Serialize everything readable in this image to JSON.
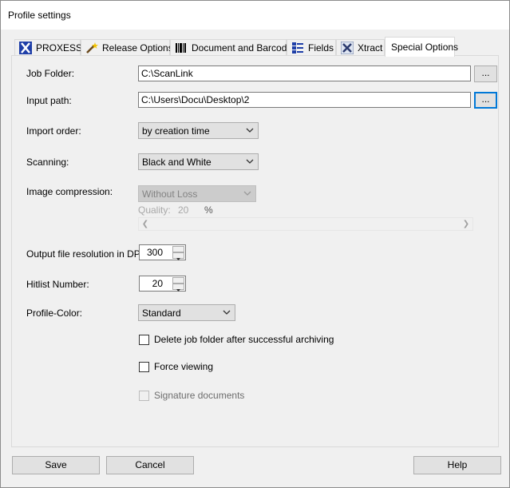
{
  "window": {
    "title": "Profile settings"
  },
  "tabs": [
    {
      "label": "PROXESS",
      "icon": "proxess-x-icon"
    },
    {
      "label": "Release Options",
      "icon": "magic-wand-icon"
    },
    {
      "label": "Document and Barcode",
      "icon": "barcode-icon"
    },
    {
      "label": "Fields",
      "icon": "fields-icon"
    },
    {
      "label": "Xtract",
      "icon": "xtract-icon"
    },
    {
      "label": "Special Options",
      "active": true
    }
  ],
  "form": {
    "job_folder": {
      "label": "Job Folder:",
      "value": "C:\\ScanLink",
      "browse": "..."
    },
    "input_path": {
      "label": "Input path:",
      "value": "C:\\Users\\Docu\\Desktop\\2",
      "browse": "..."
    },
    "import_order": {
      "label": "Import order:",
      "value": "by creation time"
    },
    "scanning": {
      "label": "Scanning:",
      "value": "Black and White"
    },
    "image_compression": {
      "label": "Image compression:",
      "value": "Without Loss",
      "quality_label": "Quality:",
      "quality_value": "20",
      "quality_unit": "%"
    },
    "dpi": {
      "label": "Output file resolution in DPI:",
      "value": "300"
    },
    "hitlist": {
      "label": "Hitlist Number:",
      "value": "20"
    },
    "profile_color": {
      "label": "Profile-Color:",
      "value": "Standard"
    },
    "checkboxes": {
      "delete_job": "Delete job folder after successful archiving",
      "force_view": "Force viewing",
      "signature": "Signature documents"
    }
  },
  "buttons": {
    "save": "Save",
    "cancel": "Cancel",
    "help": "Help"
  },
  "colors": {
    "focus": "#0078d7",
    "disabled_text": "#6d6d6d"
  }
}
